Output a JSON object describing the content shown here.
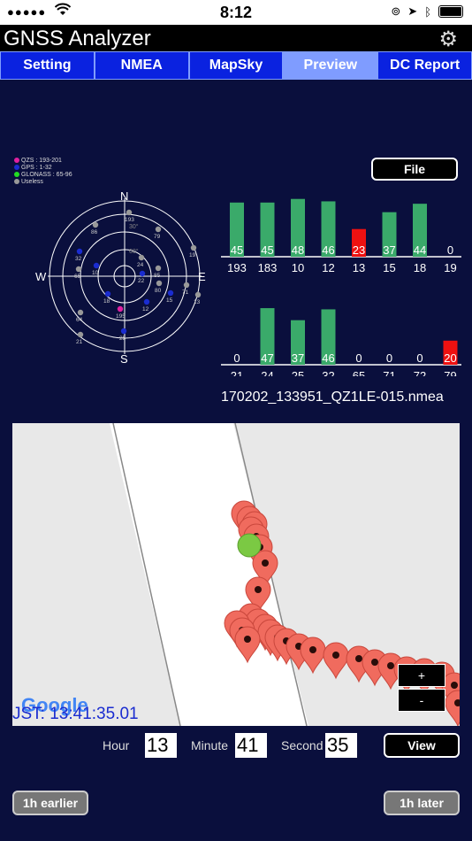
{
  "status": {
    "dots": "●●●●●",
    "time": "8:12"
  },
  "app": {
    "title": "GNSS Analyzer"
  },
  "tabs": [
    {
      "label": "Setting"
    },
    {
      "label": "NMEA"
    },
    {
      "label": "MapSky"
    },
    {
      "label": "Preview",
      "active": true
    },
    {
      "label": "DC Report"
    }
  ],
  "legend": {
    "items": [
      {
        "label": "QZS : 193-201",
        "color": "#e020a0"
      },
      {
        "label": "GPS : 1-32",
        "color": "#1a2cd0"
      },
      {
        "label": "GLONASS : 65-96",
        "color": "#22dd22"
      },
      {
        "label": "Useless",
        "color": "#999999"
      }
    ]
  },
  "skyplot": {
    "north": "N",
    "south": "S",
    "east": "E",
    "west": "W",
    "ring_labels": [
      "30°",
      "60°"
    ],
    "satellites": [
      {
        "id": "193",
        "color": "#999999"
      },
      {
        "id": "86",
        "color": "#999999"
      },
      {
        "id": "79",
        "color": "#999999"
      },
      {
        "id": "19",
        "color": "#999999"
      },
      {
        "id": "32",
        "color": "#1a2cd0"
      },
      {
        "id": "65",
        "color": "#999999"
      },
      {
        "id": "24",
        "color": "#999999"
      },
      {
        "id": "10",
        "color": "#1a2cd0"
      },
      {
        "id": "85",
        "color": "#999999"
      },
      {
        "id": "22",
        "color": "#1a2cd0"
      },
      {
        "id": "80",
        "color": "#999999"
      },
      {
        "id": "71",
        "color": "#999999"
      },
      {
        "id": "15",
        "color": "#1a2cd0"
      },
      {
        "id": "13",
        "color": "#999999"
      },
      {
        "id": "18",
        "color": "#1a2cd0"
      },
      {
        "id": "12",
        "color": "#1a2cd0"
      },
      {
        "id": "195",
        "color": "#e020a0"
      },
      {
        "id": "64",
        "color": "#999999"
      },
      {
        "id": "25",
        "color": "#1a2cd0"
      },
      {
        "id": "21",
        "color": "#999999"
      }
    ]
  },
  "file_button": "File",
  "chart_data": [
    {
      "type": "bar",
      "categories": [
        "193",
        "183",
        "10",
        "12",
        "13",
        "15",
        "18",
        "19"
      ],
      "values": [
        45,
        45,
        48,
        46,
        23,
        37,
        44,
        0
      ],
      "colors": [
        "#3aaa6a",
        "#3aaa6a",
        "#3aaa6a",
        "#3aaa6a",
        "#ee1111",
        "#3aaa6a",
        "#3aaa6a",
        "#3aaa6a"
      ],
      "ylim": [
        0,
        50
      ]
    },
    {
      "type": "bar",
      "categories": [
        "21",
        "24",
        "25",
        "32",
        "65",
        "71",
        "72",
        "79"
      ],
      "values": [
        0,
        47,
        37,
        46,
        0,
        0,
        0,
        20
      ],
      "colors": [
        "#3aaa6a",
        "#3aaa6a",
        "#3aaa6a",
        "#3aaa6a",
        "#3aaa6a",
        "#3aaa6a",
        "#3aaa6a",
        "#ee1111"
      ],
      "ylim": [
        0,
        50
      ]
    }
  ],
  "filename": "170202_133951_QZ1LE-015.nmea",
  "map": {
    "zoom_in": "+",
    "zoom_out": "-",
    "google_logo": "Google",
    "jst": "JST: 13:41:35.01"
  },
  "time": {
    "hour_label": "Hour",
    "hour": "13",
    "minute_label": "Minute",
    "minute": "41",
    "second_label": "Second",
    "second": "35",
    "view_button": "View"
  },
  "buttons": {
    "earlier": "1h earlier",
    "later": "1h later"
  }
}
